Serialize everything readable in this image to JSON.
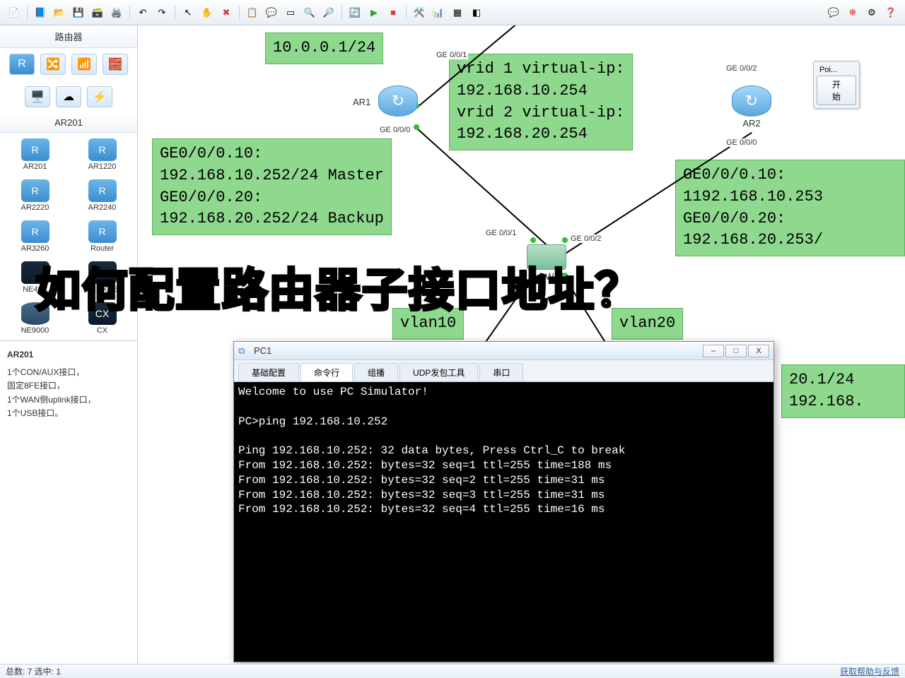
{
  "left_panel": {
    "title": "路由器",
    "section": "AR201",
    "devices": [
      {
        "label": "AR201"
      },
      {
        "label": "AR1220"
      },
      {
        "label": "AR2220"
      },
      {
        "label": "AR2240"
      },
      {
        "label": "AR3260"
      },
      {
        "label": "Router"
      },
      {
        "label": "NE40E"
      },
      {
        "label": "NE5000E"
      },
      {
        "label": "NE9000"
      },
      {
        "label": "CX"
      }
    ],
    "desc_title": "AR201",
    "desc_lines": [
      "1个CON/AUX接口，",
      "固定8FE接口，",
      "1个WAN侧uplink接口，",
      "1个USB接口。"
    ]
  },
  "canvas": {
    "anno_top": "10.0.0.1/24",
    "anno_vrid": "vrid 1 virtual-ip:\n192.168.10.254\nvrid 2 virtual-ip:\n192.168.20.254",
    "anno_left": "GE0/0/0.10:\n192.168.10.252/24 Master\nGE0/0/0.20:\n192.168.20.252/24 Backup",
    "anno_right": "GE0/0/0.10:\n1192.168.10.253\nGE0/0/0.20:\n192.168.20.253/",
    "anno_bottom1": "20.1/24\n192.168.",
    "vlan1": "vlan10",
    "vlan2": "vlan20",
    "ar1": "AR1",
    "ar2": "AR2",
    "sw": "SW",
    "ports": {
      "ge001_top": "GE 0/0/1",
      "ge002_top": "GE 0/0/2",
      "ge000_ar1": "GE 0/0/0",
      "ge000_ar2": "GE 0/0/0",
      "ge001_sw": "GE 0/0/1",
      "ge002_sw": "GE 0/0/2"
    },
    "popup": {
      "tab": "Poi...",
      "btn": "开始"
    }
  },
  "pc_window": {
    "title": "PC1",
    "tabs": [
      "基础配置",
      "命令行",
      "组播",
      "UDP发包工具",
      "串口"
    ],
    "active_tab": 1,
    "terminal": "Welcome to use PC Simulator!\n\nPC>ping 192.168.10.252\n\nPing 192.168.10.252: 32 data bytes, Press Ctrl_C to break\nFrom 192.168.10.252: bytes=32 seq=1 ttl=255 time=188 ms\nFrom 192.168.10.252: bytes=32 seq=2 ttl=255 time=31 ms\nFrom 192.168.10.252: bytes=32 seq=3 ttl=255 time=31 ms\nFrom 192.168.10.252: bytes=32 seq=4 ttl=255 time=16 ms\n"
  },
  "overlay": "如何配置路由器子接口地址？",
  "status": {
    "left": "总数: 7 选中: 1",
    "right": "获取帮助与反馈"
  }
}
